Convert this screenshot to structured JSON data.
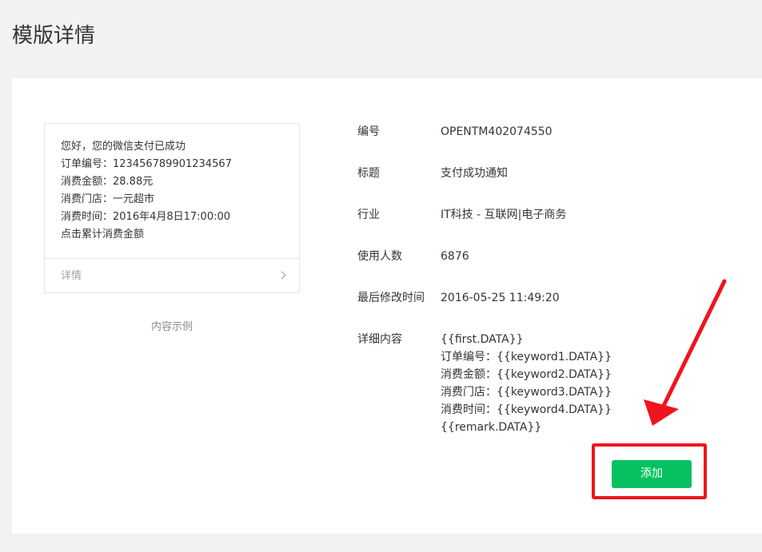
{
  "page": {
    "title": "模版详情"
  },
  "preview": {
    "lines": [
      "您好，您的微信支付已成功",
      "订单编号：123456789901234567",
      "消费金额：28.88元",
      "消费门店：一元超市",
      "消费时间：2016年4月8日17:00:00",
      "点击累计消费金额"
    ],
    "detail_label": "详情",
    "caption": "内容示例"
  },
  "info": {
    "id_label": "编号",
    "id_value": "OPENTM402074550",
    "title_label": "标题",
    "title_value": "支付成功通知",
    "industry_label": "行业",
    "industry_value": "IT科技 - 互联网|电子商务",
    "users_label": "使用人数",
    "users_value": "6876",
    "modified_label": "最后修改时间",
    "modified_value": "2016-05-25 11:49:20",
    "content_label": "详细内容",
    "content_lines": [
      "{{first.DATA}}",
      "订单编号：{{keyword1.DATA}}",
      "消费金额：{{keyword2.DATA}}",
      "消费门店：{{keyword3.DATA}}",
      "消费时间：{{keyword4.DATA}}",
      "{{remark.DATA}}"
    ]
  },
  "actions": {
    "add_label": "添加"
  },
  "colors": {
    "accent_green": "#07c160",
    "annotation_red": "#f0141e"
  },
  "icons": {
    "detail_chevron": "chevron-right-icon",
    "annotation": "red-arrow-annotation"
  }
}
